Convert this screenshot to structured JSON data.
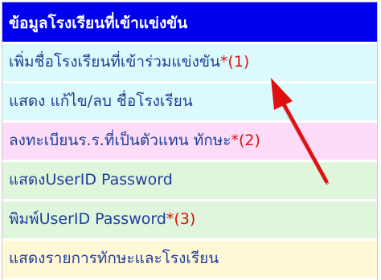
{
  "menu": {
    "title": "ข้อมูลโรงเรียนที่เข้าแข่งขัน",
    "items": [
      {
        "label": "เพิ่มชื่อโรงเรียนที่เข้าร่วมแข่งขัน",
        "mark": "*(1)"
      },
      {
        "label": "แสดง แก้ไข/ลบ ชื่อโรงเรียน",
        "mark": ""
      },
      {
        "label": "ลงทะเบียนร.ร.ที่เป็นตัวแทน ทักษะ",
        "mark": "*(2)"
      },
      {
        "label": "แสดงUserID Password",
        "mark": ""
      },
      {
        "label": "พิมพ์UserID Password",
        "mark": "*(3)"
      },
      {
        "label": "แสดงรายการทักษะและโรงเรียน",
        "mark": ""
      }
    ]
  },
  "colors": {
    "header": "#0000ee",
    "item_cyan": "#dcfafc",
    "item_pink": "#fcdcf8",
    "item_green": "#dff5dc",
    "item_yellow": "#fff8d6",
    "link_text": "#1e3f99",
    "mark_red": "#dd1111",
    "arrow": "#e01010"
  },
  "annotation": {
    "icon": "red-arrow-icon"
  }
}
